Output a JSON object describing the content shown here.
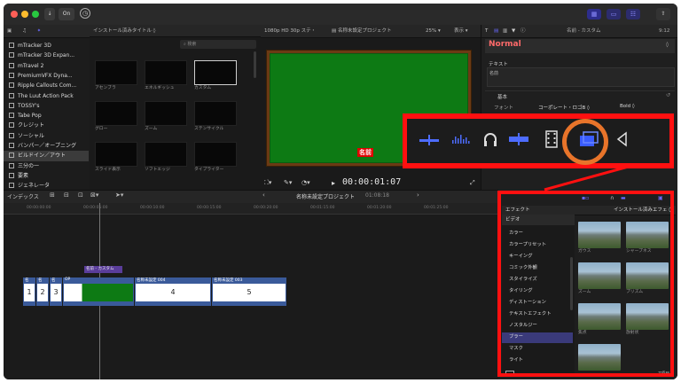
{
  "titlebar": {
    "check_label": "✓",
    "key_label": "⚷",
    "down_label": "↓",
    "check2_label": "On",
    "clock_label": "◷",
    "share_label": "⇧"
  },
  "library": {
    "header_label": "インストール済みタイトル ◊",
    "search_placeholder": "検索",
    "items": [
      "mTracker 3D",
      "mTracker 3D Expan...",
      "mTravel 2",
      "PremiumVFX Dyna...",
      "Ripple Callouts Com...",
      "The Luut Action Pack",
      "TOSSY's",
      "Tabe Pop",
      "クレジット",
      "ソーシャル",
      "バンパー／オープニング",
      "ビルドイン／アウト",
      "三分の一",
      "要素",
      "ジェネレータ"
    ],
    "thumbs": [
      {
        "caption": "アセンブラ"
      },
      {
        "caption": "エネルギッシュ"
      },
      {
        "caption": "カスタム"
      },
      {
        "caption": "グロー"
      },
      {
        "caption": "ズーム"
      },
      {
        "caption": "ステンサイクル"
      },
      {
        "caption": "スライド表示"
      },
      {
        "caption": "ソフトエッジ"
      },
      {
        "caption": "タイプライター"
      }
    ]
  },
  "viewer": {
    "format": "1080p HD 30p ステ・",
    "project": "名称未設定プロジェクト",
    "zoom": "25% ▾",
    "view": "表示 ▾",
    "caption": "名前",
    "timecode": "00:00:01:07",
    "play": "▸"
  },
  "inspector": {
    "title": "名前 - カスタム",
    "duration": "9:12",
    "normal": "Normal",
    "text_label": "テキスト",
    "name_field": "名前",
    "section_basic": "基本",
    "font_label": "フォント",
    "font_value": "コーポレート・ロゴB ◊",
    "weight_value": "Bold ◊"
  },
  "timeline": {
    "index_label": "インデックス",
    "project": "名称未設定プロジェクト",
    "duration": "01:08:18",
    "ruler": [
      "00:00:00:00",
      "00:00:05:00",
      "00:00:10:00",
      "00:00:15:00",
      "00:00:20:00",
      "00:01:15:00",
      "00:01:20:00",
      "00:01:25:00"
    ],
    "title_clip": "名前 - カスタム",
    "clips": [
      {
        "label": "名",
        "num": "1"
      },
      {
        "label": "名",
        "num": "2"
      },
      {
        "label": "名",
        "num": "3"
      },
      {
        "label": "OP",
        "num": ""
      },
      {
        "label": "名称未設定 004",
        "num": "4"
      },
      {
        "label": "名称未設定 003",
        "num": "5"
      }
    ]
  },
  "effects": {
    "header_label": "エフェクト",
    "header_right": "インストール済みエフェ ◊",
    "video_label": "ビデオ",
    "items": [
      "カラー",
      "カラープリセット",
      "キーイング",
      "コミック外観",
      "スタイライズ",
      "タイリング",
      "ディストーション",
      "テキストエフェクト",
      "ノスタルジー",
      "ブラー",
      "マスク",
      "ライト"
    ],
    "selected": "ブラー",
    "thumbs": [
      {
        "caption": "ガウス"
      },
      {
        "caption": "シャープネス"
      },
      {
        "caption": "ズーム"
      },
      {
        "caption": "プリズム"
      },
      {
        "caption": "焦点"
      },
      {
        "caption": "放射状"
      },
      {
        "caption": ""
      }
    ],
    "count": "7項目"
  },
  "colors": {
    "accent": "#5a5aff",
    "highlight_red": "#ff1010",
    "orange_circle": "#e8742a",
    "viewer_green": "#0d7a14",
    "inspector_normal": "#ff6a6a"
  }
}
